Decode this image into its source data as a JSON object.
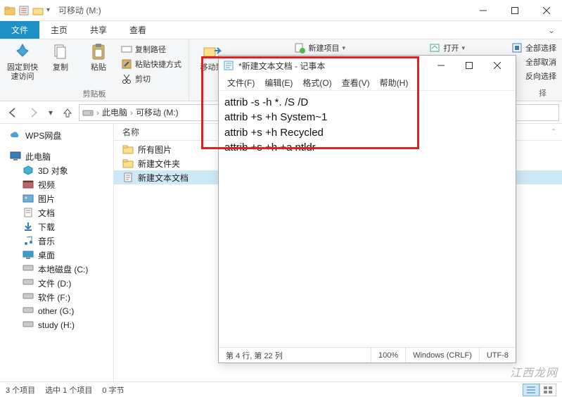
{
  "titlebar": {
    "title": "可移动 (M:)"
  },
  "tabs": {
    "file": "文件",
    "home": "主页",
    "share": "共享",
    "view": "查看"
  },
  "ribbon": {
    "pin": "固定到快\n速访问",
    "copy": "复制",
    "paste": "粘贴",
    "copypath": "复制路径",
    "pasteshortcut": "粘贴快捷方式",
    "cut": "剪切",
    "clipboard_label": "剪贴板",
    "moveto": "移动到",
    "newitem": "新建项目",
    "open": "打开",
    "selectall": "全部选择",
    "deselect": "全部取消",
    "invert": "反向选择",
    "select_label": "择"
  },
  "breadcrumb": {
    "root": "此电脑",
    "drive": "可移动 (M:)"
  },
  "sidebar": {
    "wps": "WPS网盘",
    "thispc": "此电脑",
    "obj3d": "3D 对象",
    "videos": "视频",
    "pictures": "图片",
    "documents": "文档",
    "downloads": "下载",
    "music": "音乐",
    "desktop": "桌面",
    "localc": "本地磁盘 (C:)",
    "d": "文件 (D:)",
    "f": "软件 (F:)",
    "g": "other (G:)",
    "h": "study (H:)"
  },
  "columns": {
    "name": "名称"
  },
  "files": [
    {
      "name": "所有图片",
      "type": "folder"
    },
    {
      "name": "新建文件夹",
      "type": "folder"
    },
    {
      "name": "新建文本文档",
      "type": "text",
      "selected": true
    }
  ],
  "statusbar": {
    "count": "3 个项目",
    "sel": "选中 1 个项目",
    "size": "0 字节"
  },
  "notepad": {
    "title": "*新建文本文档 - 记事本",
    "menu": {
      "file": "文件(F)",
      "edit": "编辑(E)",
      "format": "格式(O)",
      "view": "查看(V)",
      "help": "帮助(H)"
    },
    "lines": [
      "attrib -s -h *. /S /D",
      "attrib +s +h System~1",
      "attrib +s +h Recycled",
      "attrib +s +h +a ntldr"
    ],
    "status": {
      "pos": "第 4 行, 第 22 列",
      "zoom": "100%",
      "eol": "Windows (CRLF)",
      "enc": "UTF-8"
    }
  },
  "watermark": "江西龙网"
}
